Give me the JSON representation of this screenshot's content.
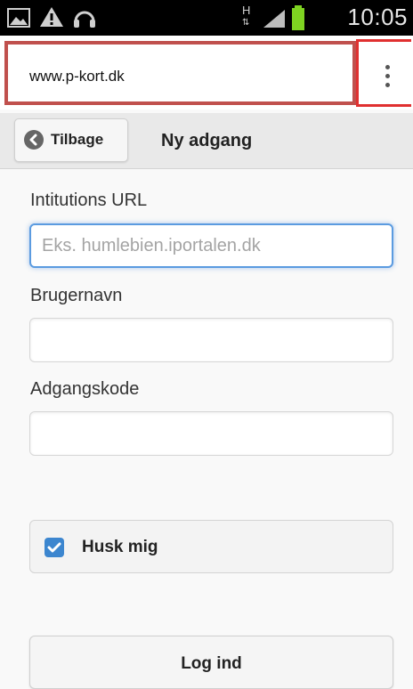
{
  "status_bar": {
    "time": "10:05",
    "network": "H"
  },
  "browser": {
    "url": "www.p-kort.dk",
    "menu_icon": "overflow-menu-icon"
  },
  "header": {
    "back_label": "Tilbage",
    "title": "Ny adgang"
  },
  "form": {
    "institution_label": "Intitutions URL",
    "institution_placeholder": "Eks. humlebien.iportalen.dk",
    "username_label": "Brugernavn",
    "password_label": "Adgangskode",
    "remember_label": "Husk mig",
    "remember_checked": true,
    "submit_label": "Log ind"
  },
  "colors": {
    "highlight_red": "#c0504d",
    "accent_blue": "#3c86cf"
  }
}
